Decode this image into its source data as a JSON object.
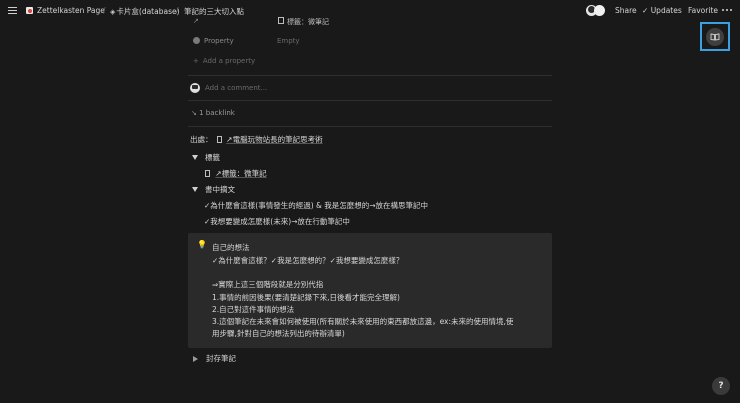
{
  "topbar": {
    "crumb1": "Zettelkasten Page",
    "crumb2": "卡片盒(database)",
    "crumb3": "筆記的三大切入點",
    "share": "Share",
    "updates": "Updates",
    "favorite": "Favorite"
  },
  "properties": {
    "row1_value": "標籤：微筆記",
    "property_label": "Property",
    "property_value": "Empty",
    "add_property": "Add a property"
  },
  "comment": {
    "placeholder": "Add a comment..."
  },
  "backlinks": {
    "label": "1 backlink"
  },
  "content": {
    "source_prefix": "出處：",
    "source_link": "↗電腦玩物站長的筆記思考術",
    "toggle_tags": "標籤",
    "tag_link": "↗標籤：微筆記",
    "toggle_excerpt": "書中摘文",
    "excerpt1": "✓為什麼會這樣(事情發生的經過) & 我是怎麼想的→放在構思筆記中",
    "excerpt2": "✓我想要變成怎麼樣(未來)→放在行動筆記中",
    "callout_title": "自己的想法",
    "callout_lines": [
      "✓為什麼會這樣？✓我是怎麼想的？✓我想要變成怎麼樣？",
      "",
      "⇒實際上這三個階段就是分別代指",
      "1.事情的前因後果(要清楚記錄下來,日後看才能完全理解)",
      "2.自己對這件事情的想法",
      "3.這個筆記在未來會如何被使用(所有關於未來使用的東西都放這邊，ex:未來的使用情境,使",
      "用步驟,針對自己的想法列出的待辦清單)"
    ],
    "toggle_archive": "封存筆記"
  },
  "help": {
    "label": "?"
  }
}
